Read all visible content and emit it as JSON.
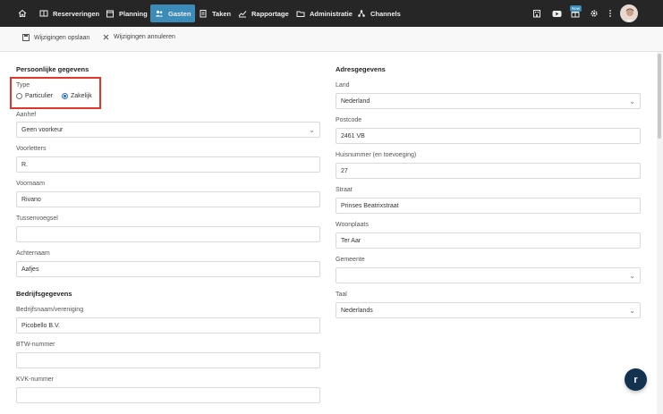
{
  "nav": {
    "items": [
      {
        "label": "Reserveringen",
        "icon": "book-icon"
      },
      {
        "label": "Planning",
        "icon": "calendar-icon"
      },
      {
        "label": "Gasten",
        "icon": "users-icon",
        "active": true
      },
      {
        "label": "Taken",
        "icon": "clipboard-icon"
      },
      {
        "label": "Rapportage",
        "icon": "chart-icon"
      },
      {
        "label": "Administratie",
        "icon": "folder-icon"
      },
      {
        "label": "Channels",
        "icon": "network-icon"
      }
    ],
    "badge": "New",
    "accent": "#3b8cb8"
  },
  "toolbar": {
    "save_label": "Wijzigingen opslaan",
    "cancel_label": "Wijzigingen annuleren"
  },
  "personal": {
    "title": "Persoonlijke gegevens",
    "type_label": "Type",
    "type_options": [
      "Particulier",
      "Zakelijk"
    ],
    "type_selected": "Zakelijk",
    "aanhef_label": "Aanhef",
    "aanhef_value": "Geen voorkeur",
    "voorletters_label": "Voorletters",
    "voorletters_value": "R.",
    "voornaam_label": "Voornaam",
    "voornaam_value": "Rivano",
    "tussenvoegsel_label": "Tussenvoegsel",
    "tussenvoegsel_value": "",
    "achternaam_label": "Achternaam",
    "achternaam_value": "Aafjes"
  },
  "company": {
    "title": "Bedrijfsgegevens",
    "name_label": "Bedrijfsnaam/vereniging",
    "name_value": "Picobello B.V.",
    "btw_label": "BTW-nummer",
    "btw_value": "",
    "kvk_label": "KVK-nummer",
    "kvk_value": ""
  },
  "address": {
    "title": "Adresgegevens",
    "land_label": "Land",
    "land_value": "Nederland",
    "postcode_label": "Postcode",
    "postcode_value": "2461 VB",
    "huisnummer_label": "Huisnummer (en toevoeging)",
    "huisnummer_value": "27",
    "straat_label": "Straat",
    "straat_value": "Prinses Beatrixstraat",
    "woonplaats_label": "Woonplaats",
    "woonplaats_value": "Ter Aar",
    "gemeente_label": "Gemeente",
    "gemeente_value": "",
    "taal_label": "Taal",
    "taal_value": "Nederlands"
  },
  "fab_letter": "r",
  "highlight_color": "#e0362a"
}
